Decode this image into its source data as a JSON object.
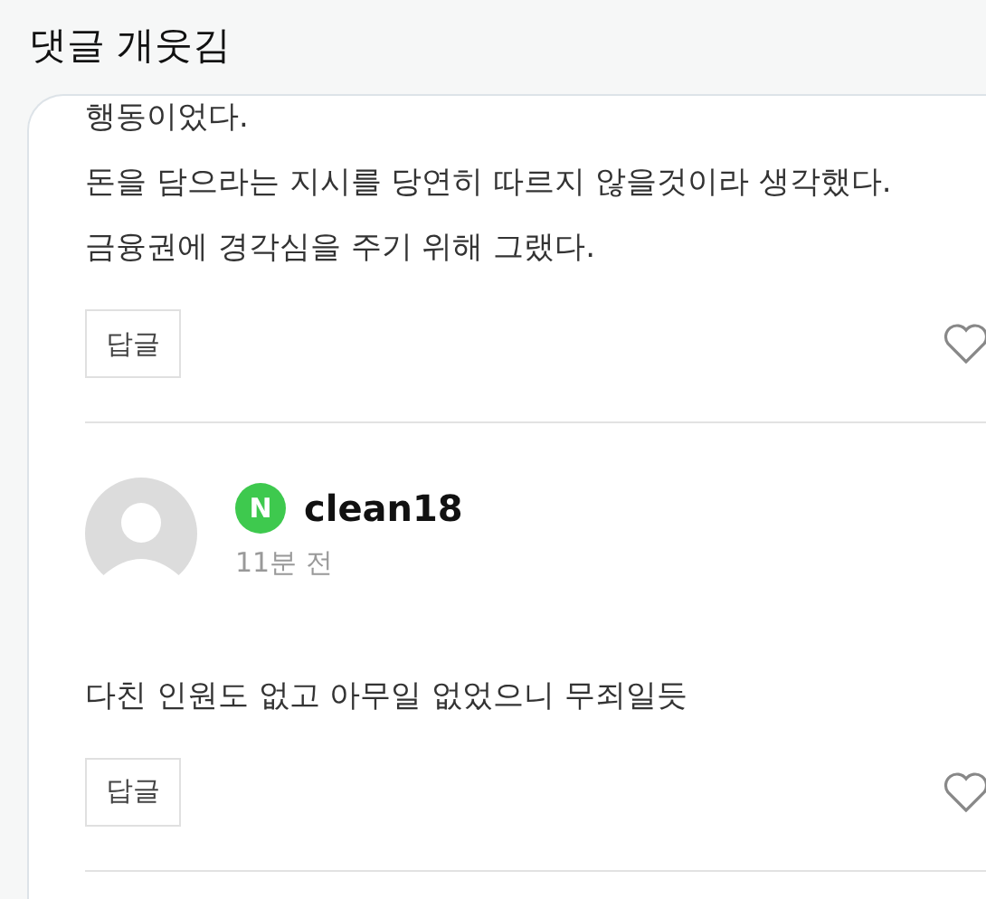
{
  "header": {
    "title": "댓글 개웃김"
  },
  "comments": [
    {
      "lines": [
        "행동이었다.",
        "돈을 담으라는 지시를 당연히 따르지 않을것이라 생각했다.",
        "금융권에 경각심을 주기 위해 그랬다."
      ],
      "reply_label": "답글",
      "liked": false
    },
    {
      "author": "clean18",
      "time": "11분 전",
      "badge": "N",
      "lines": [
        "다친 인원도 없고 아무일 없었으니 무죄일듯"
      ],
      "reply_label": "답글",
      "liked": false
    }
  ]
}
